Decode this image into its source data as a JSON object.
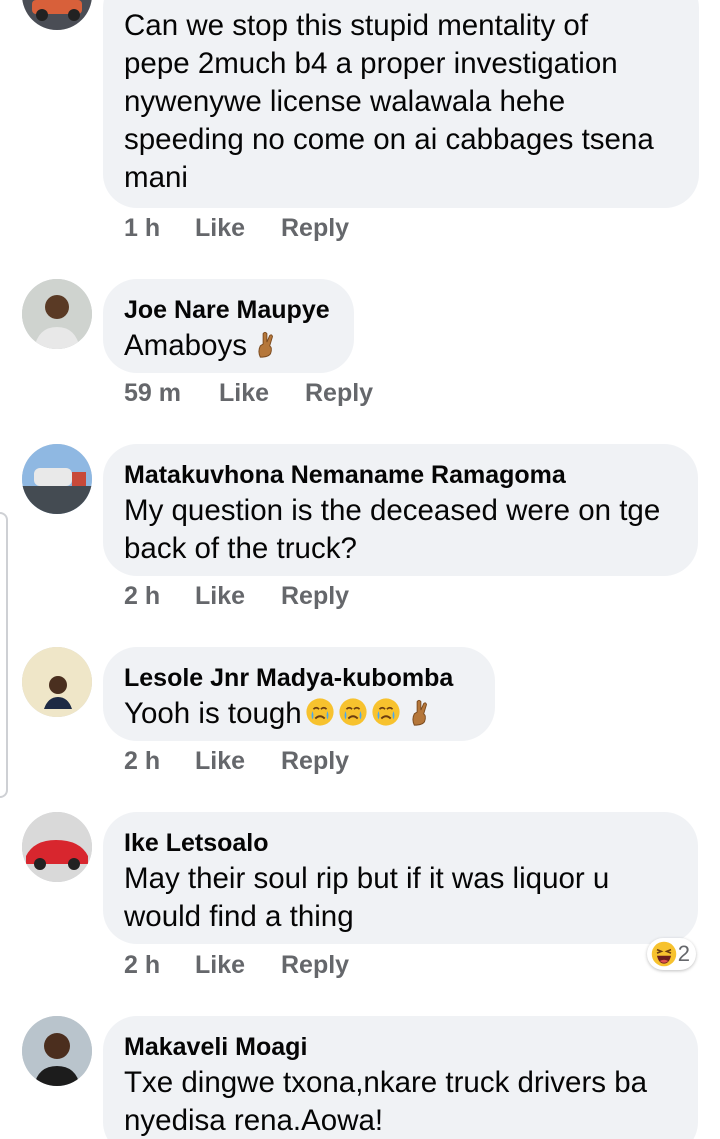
{
  "comments": [
    {
      "author": "",
      "text": "Can we stop this stupid mentality of\npepe 2much b4 a proper investigation\nnywenywe license walawala hehe\nspeeding no come on ai cabbages tsena\nmani",
      "time": "1 h",
      "like": "Like",
      "reply": "Reply"
    },
    {
      "author": "Joe Nare Maupye",
      "text": "Amaboys",
      "emojis": [
        "crossed-fingers-emoji"
      ],
      "time": "59 m",
      "like": "Like",
      "reply": "Reply"
    },
    {
      "author": "Matakuvhona Nemaname Ramagoma",
      "text": "My question is the deceased were on tge\nback of the truck?",
      "time": "2 h",
      "like": "Like",
      "reply": "Reply"
    },
    {
      "author": "Lesole Jnr Madya-kubomba",
      "text": "Yooh is tough",
      "emojis": [
        "crying-face-emoji",
        "crying-face-emoji",
        "crying-face-emoji",
        "crossed-fingers-emoji"
      ],
      "time": "2 h",
      "like": "Like",
      "reply": "Reply"
    },
    {
      "author": "Ike Letsoalo",
      "text": "May their soul rip but if it was liquor u\nwould find a thing",
      "time": "2 h",
      "like": "Like",
      "reply": "Reply",
      "reaction": {
        "icon": "laughing-face-icon",
        "count": "2"
      }
    },
    {
      "author": "Makaveli Moagi",
      "text": "Txe dingwe txona,nkare truck drivers ba\nnyedisa rena.Aowa!"
    }
  ],
  "colors": {
    "bubble": "#f0f2f5",
    "text": "#050505",
    "meta": "#65676b"
  }
}
